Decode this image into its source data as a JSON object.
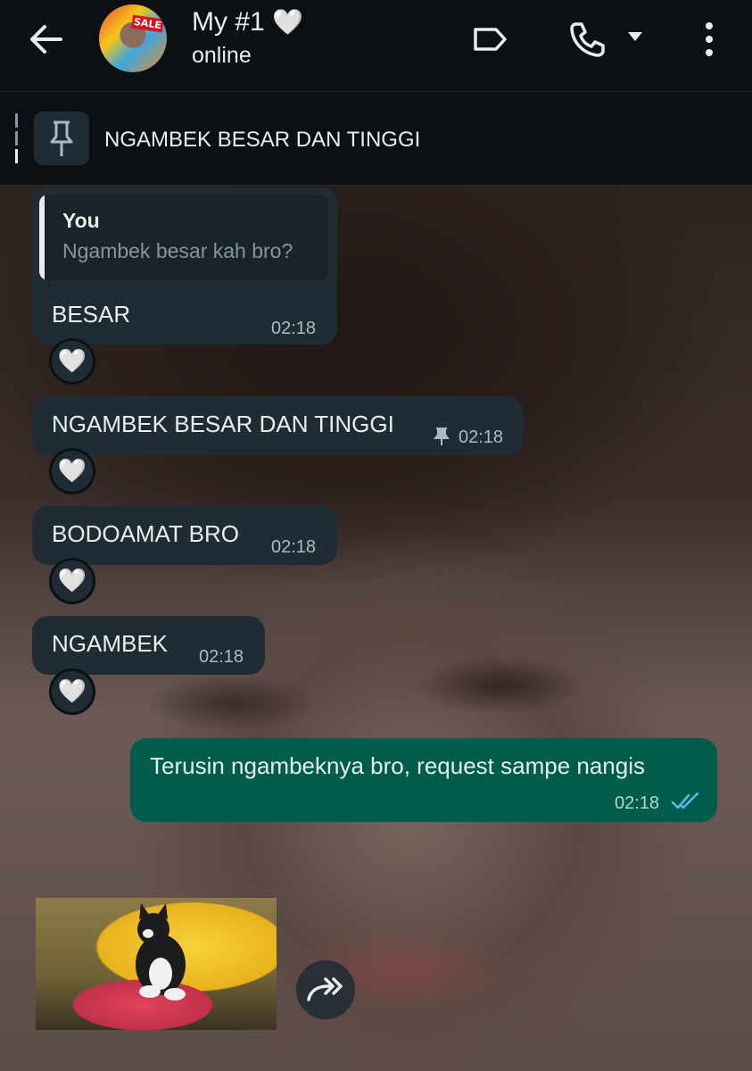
{
  "header": {
    "contact_name": "My #1",
    "name_emoji": "🤍",
    "status": "online",
    "avatar_sticker_text": "SALE",
    "icons": [
      "back-arrow-icon",
      "label-icon",
      "phone-icon",
      "caret-down-icon",
      "more-vert-icon"
    ]
  },
  "pinned": {
    "text": "NGAMBEK BESAR DAN TINGGI",
    "icon": "pin-icon"
  },
  "messages": [
    {
      "quote_author": "You",
      "quote_text": "Ngambek besar kah bro?",
      "text": "BESAR",
      "time": "02:18",
      "reaction": "🤍"
    },
    {
      "text": "NGAMBEK BESAR DAN TINGGI",
      "time": "02:18",
      "pinned": true,
      "reaction": "🤍"
    },
    {
      "text": "BODOAMAT BRO",
      "time": "02:18",
      "reaction": "🤍"
    },
    {
      "text": "NGAMBEK",
      "time": "02:18",
      "reaction": "🤍"
    }
  ],
  "outgoing": {
    "text": "Terusin ngambeknya bro, request sampe nangis",
    "time": "02:18",
    "status": "read",
    "tick_color": "#53bdeb"
  },
  "sticker": {
    "icon": "cat-sticker",
    "action_icon": "forward-icon"
  },
  "colors": {
    "incoming_bubble": "#202c33",
    "outgoing_bubble": "#005c4b",
    "background": "#0b1014"
  }
}
